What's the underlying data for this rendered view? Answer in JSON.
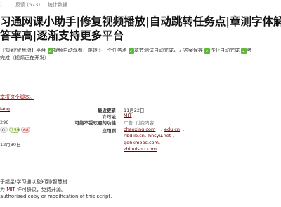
{
  "tabs": {
    "prefix": "反馈",
    "feedback": "反馈 (573)",
    "stats": "统计数据"
  },
  "script": {
    "title_line1": "习通网课小助手|修复视频播放|自动跳转任务点|章测字体解",
    "title_line2": "答率高|逐渐支持更多平台",
    "desc_line1": {
      "part1": "【知到/智慧树】平台",
      "part2": "视频自动观看，跳转下一个任务点",
      "part3": "章节测试自动完成，无答案保存",
      "part4": "作业自动完成",
      "part5": "考"
    },
    "desc_line2": "完成（视频正在开发）",
    "report_link": "举报这个脚本。"
  },
  "stats": {
    "author": "iang",
    "installs": "296",
    "ratings": [
      "0",
      "159",
      "68"
    ],
    "created": "12月30日"
  },
  "meta": {
    "updated_label": "最近更新",
    "updated_value": "11月22日",
    "license_label": "许可证",
    "license_value": "MIT",
    "antifeature_label": "可能不受欢迎的功能",
    "antifeature_value": "广告, 付费内容",
    "applies_label": "应用到",
    "applies_values": [
      "chaoxing.com",
      "edu.cn",
      "nbdlib.cn",
      "hnsyu.net",
      "gdhkmooc.com",
      "zhihuishu.com"
    ]
  },
  "bottom": {
    "line1": "于超星/学习通以及知到/智慧树",
    "line2_prefix": "为",
    "line2_link": "MIT",
    "line2_suffix": "许可协议，免费开源。",
    "line3": "authorized copy or modification of this script."
  }
}
